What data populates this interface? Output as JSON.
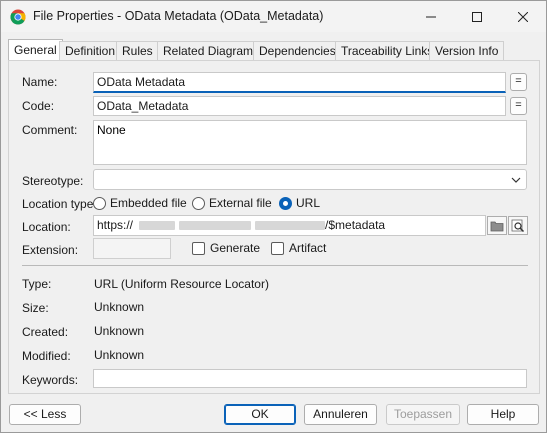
{
  "window": {
    "title": "File Properties - OData Metadata (OData_Metadata)",
    "app_icon": "chrome-icon",
    "controls": [
      "minimize-icon",
      "maximize-icon",
      "close-icon"
    ]
  },
  "tabs": [
    {
      "label": "General",
      "active": true
    },
    {
      "label": "Definition"
    },
    {
      "label": "Rules"
    },
    {
      "label": "Related Diagrams"
    },
    {
      "label": "Dependencies"
    },
    {
      "label": "Traceability Links"
    },
    {
      "label": "Version Info"
    }
  ],
  "form": {
    "name_label": "Name:",
    "name_value": "OData Metadata",
    "code_label": "Code:",
    "code_value": "OData_Metadata",
    "eq_label": "=",
    "comment_label": "Comment:",
    "comment_value": "None",
    "stereotype_label": "Stereotype:",
    "stereotype_value": "",
    "location_type_label": "Location type:",
    "location_type_options": [
      "Embedded file",
      "External file",
      "URL"
    ],
    "location_type_selected": "URL",
    "location_label": "Location:",
    "location_prefix": "https://",
    "location_suffix": "/$metadata",
    "extension_label": "Extension:",
    "extension_value": "",
    "generate_label": "Generate",
    "artifact_label": "Artifact",
    "type_label": "Type:",
    "type_value": "URL (Uniform Resource Locator)",
    "size_label": "Size:",
    "size_value": "Unknown",
    "created_label": "Created:",
    "created_value": "Unknown",
    "modified_label": "Modified:",
    "modified_value": "Unknown",
    "keywords_label": "Keywords:",
    "keywords_value": ""
  },
  "buttons": {
    "less": "<< Less",
    "ok": "OK",
    "cancel": "Annuleren",
    "apply": "Toepassen",
    "help": "Help"
  },
  "colors": {
    "accent": "#0a62b8",
    "background": "#f0f0f0"
  }
}
